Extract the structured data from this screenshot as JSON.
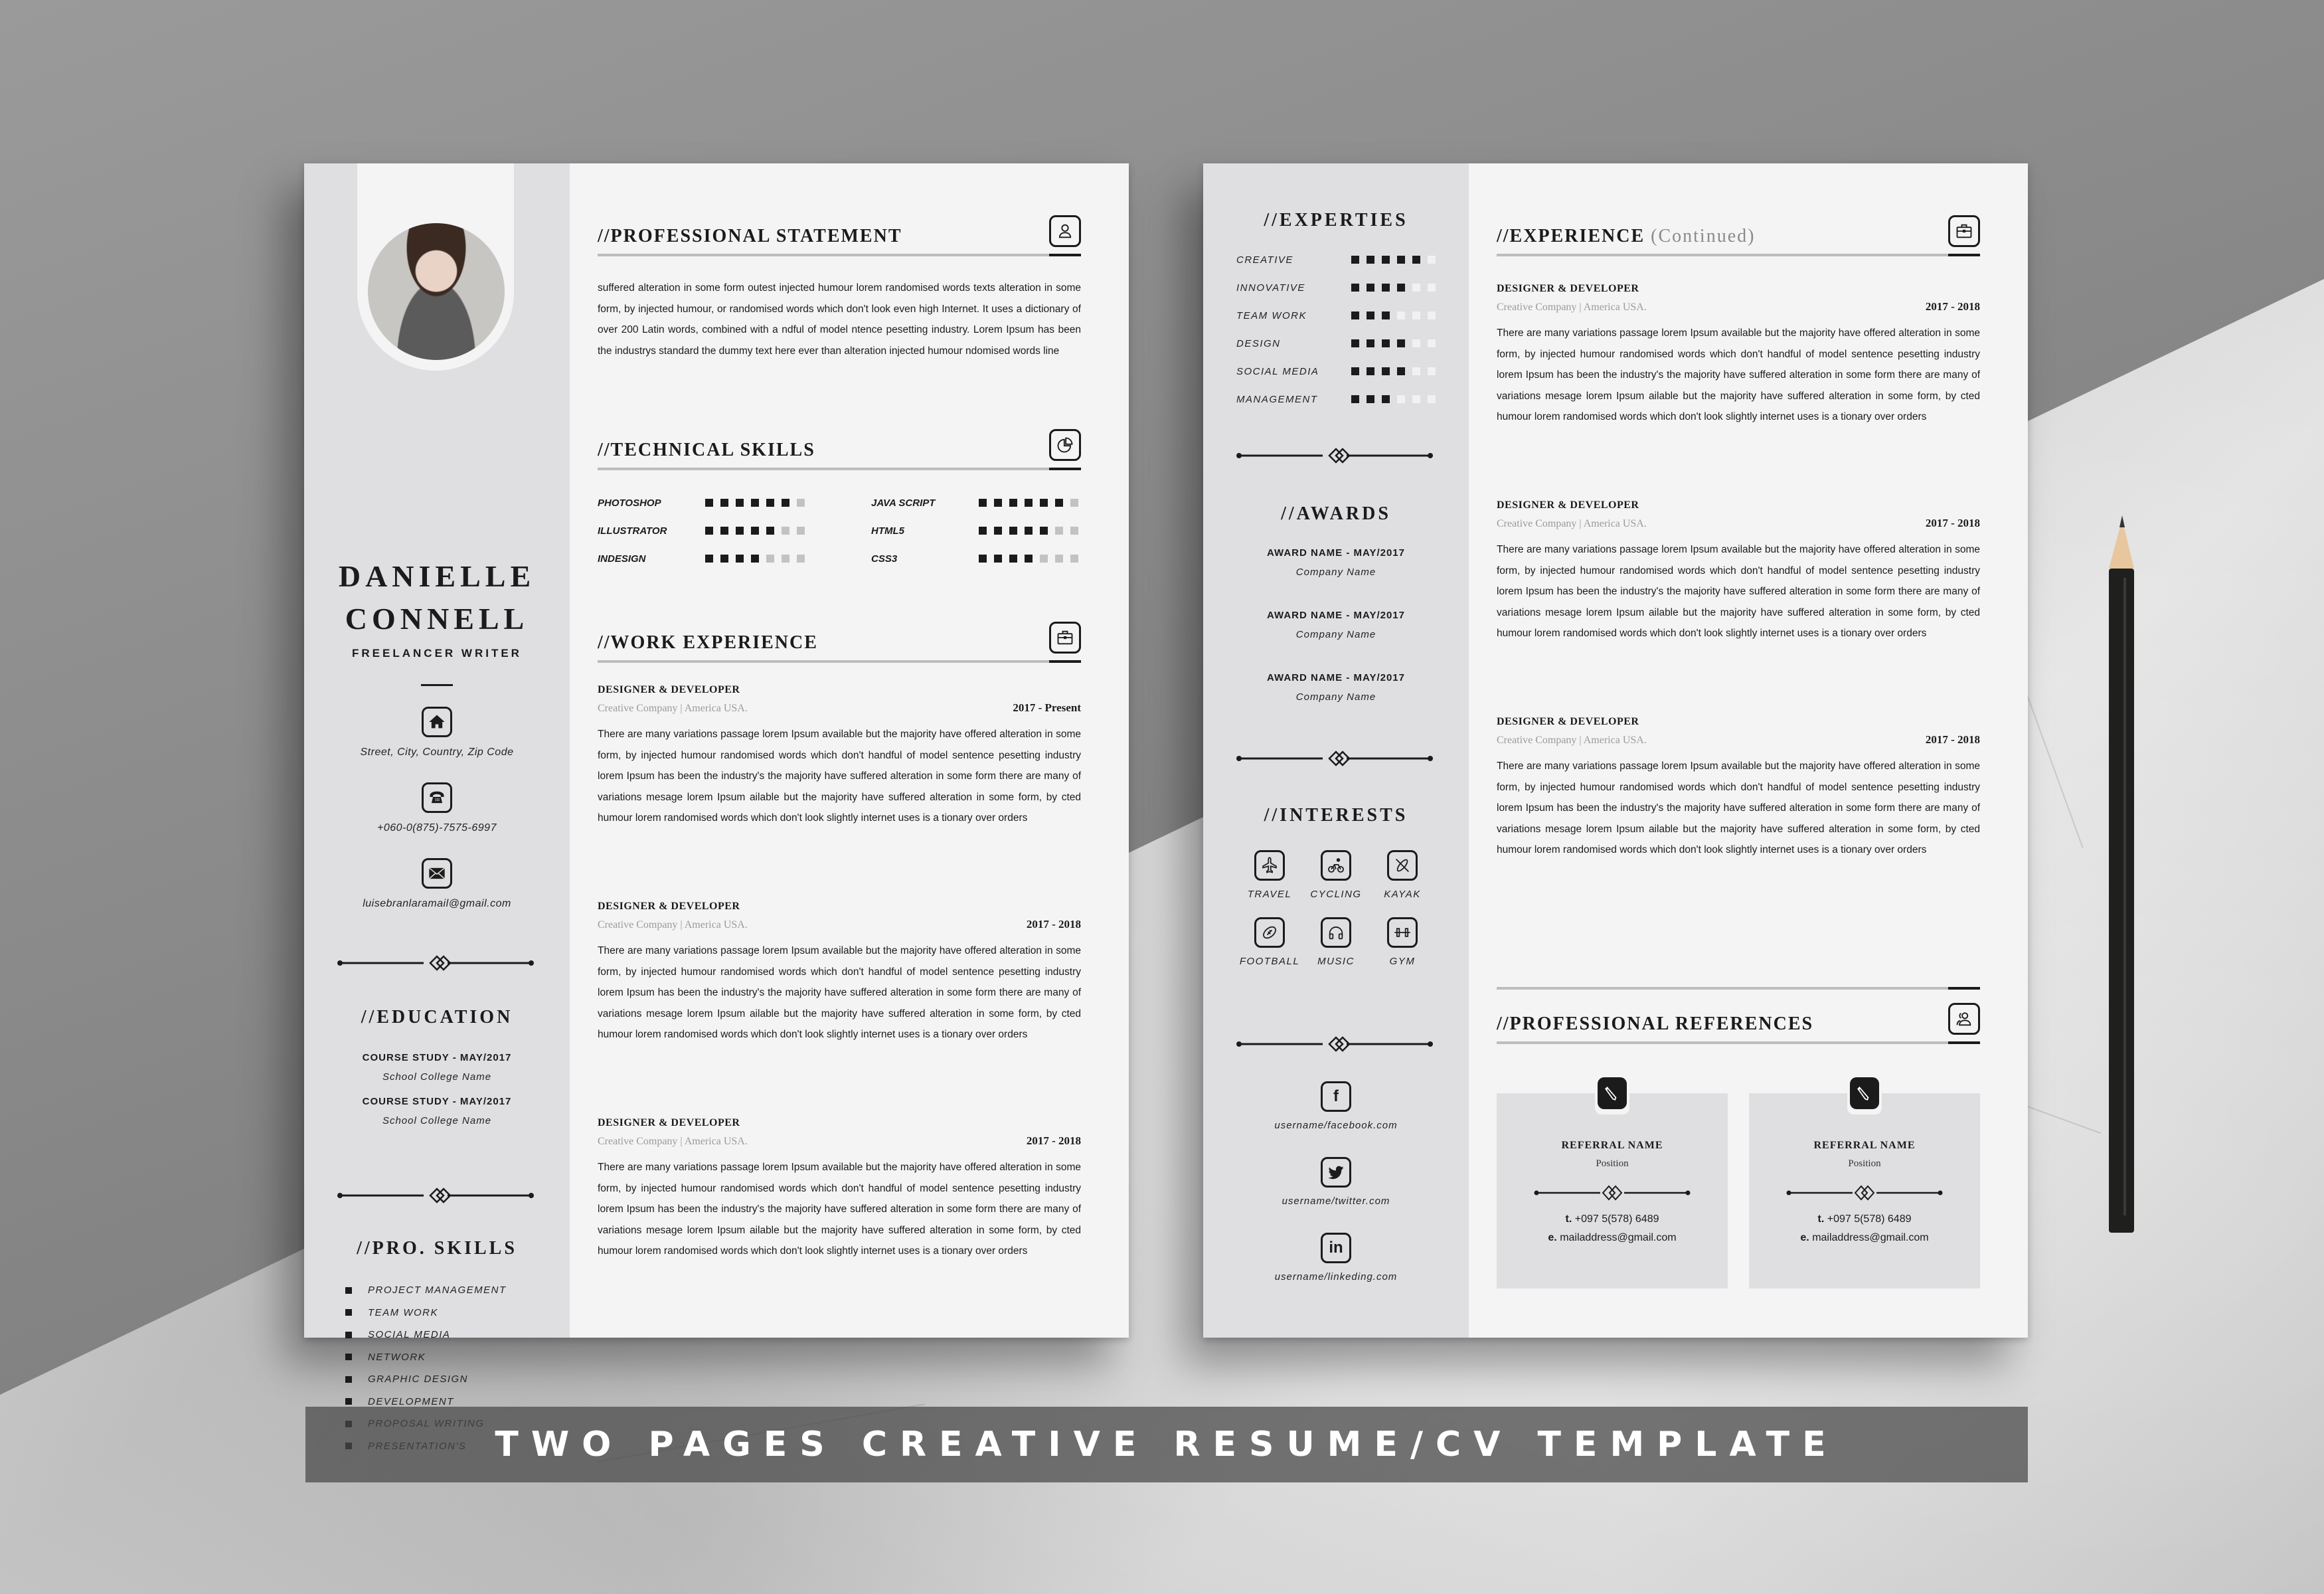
{
  "banner": {
    "title": "TWO PAGES CREATIVE RESUME/CV TEMPLATE"
  },
  "page1": {
    "profile": {
      "first_name": "DANIELLE",
      "last_name": "CONNELL",
      "role": "FREELANCER WRITER",
      "photo_icon": "portrait-photo"
    },
    "contact": [
      {
        "icon": "home-icon",
        "text": "Street, City, Country, Zip Code"
      },
      {
        "icon": "phone-icon",
        "text": "+060-0(875)-7575-6997"
      },
      {
        "icon": "envelope-icon",
        "text": "luisebranlaramail@gmail.com"
      }
    ],
    "education": {
      "heading": "//EDUCATION",
      "items": [
        {
          "title": "COURSE STUDY - MAY/2017",
          "school": "School College Name"
        },
        {
          "title": "COURSE STUDY - MAY/2017",
          "school": "School College Name"
        }
      ]
    },
    "pro_skills": {
      "heading": "//PRO. SKILLS",
      "items": [
        "PROJECT MANAGEMENT",
        "TEAM WORK",
        "SOCIAL MEDIA",
        "NETWORK",
        "GRAPHIC DESIGN",
        "DEVELOPMENT",
        "PROPOSAL WRITING",
        "PRESENTATION'S"
      ]
    },
    "statement": {
      "heading": "//PROFESSIONAL STATEMENT",
      "icon": "user-icon",
      "text": "suffered alteration in some form outest injected humour lorem randomised words texts alteration in some form, by injected humour, or randomised words which don't look even high Internet. It uses a dictionary of over 200 Latin words, combined with a ndful of model ntence pesetting industry. Lorem Ipsum has been the industrys standard the dummy text here ever than alteration injected humour ndomised words line"
    },
    "technical_skills": {
      "heading": "//TECHNICAL SKILLS",
      "icon": "pie-chart-icon",
      "max": 7,
      "items": [
        {
          "label": "PHOTOSHOP",
          "level": 6
        },
        {
          "label": "ILLUSTRATOR",
          "level": 5
        },
        {
          "label": "INDESIGN",
          "level": 4
        },
        {
          "label": "JAVA SCRIPT",
          "level": 6
        },
        {
          "label": "HTML5",
          "level": 5
        },
        {
          "label": "CSS3",
          "level": 4
        }
      ]
    },
    "work": {
      "heading": "//WORK EXPERIENCE",
      "icon": "briefcase-icon",
      "jobs": [
        {
          "title": "DESIGNER & DEVELOPER",
          "company": "Creative Company | America USA.",
          "date": "2017 - Present",
          "body": "There are many variations passage lorem Ipsum available but the majority have offered alteration in some form, by injected humour randomised words which don't handful of model sentence pesetting industry lorem Ipsum has been the industry's the majority have suffered alteration in some form there are many of variations mesage lorem Ipsum ailable but the majority have suffered alteration in some form, by cted humour lorem randomised words which don't look slightly internet uses is a tionary over orders"
        },
        {
          "title": "DESIGNER & DEVELOPER",
          "company": "Creative Company | America USA.",
          "date": "2017 - 2018",
          "body": "There are many variations passage lorem Ipsum available but the majority have offered alteration in some form, by injected humour randomised words which don't handful of model sentence pesetting industry lorem Ipsum has been the industry's the majority have suffered alteration in some form there are many of variations mesage lorem Ipsum ailable but the majority have suffered alteration in some form, by cted humour lorem randomised words which don't look slightly internet uses is a tionary over orders"
        },
        {
          "title": "DESIGNER & DEVELOPER",
          "company": "Creative Company | America USA.",
          "date": "2017 - 2018",
          "body": "There are many variations passage lorem Ipsum available but the majority have offered alteration in some form, by injected humour randomised words which don't handful of model sentence pesetting industry lorem Ipsum has been the industry's the majority have suffered alteration in some form there are many of variations mesage lorem Ipsum ailable but the majority have suffered alteration in some form, by cted humour lorem randomised words which don't look slightly internet uses is a tionary over orders"
        }
      ]
    }
  },
  "page2": {
    "experties": {
      "heading": "//EXPERTIES",
      "max": 6,
      "items": [
        {
          "label": "CREATIVE",
          "level": 5
        },
        {
          "label": "INNOVATIVE",
          "level": 4
        },
        {
          "label": "TEAM WORK",
          "level": 3
        },
        {
          "label": "DESIGN",
          "level": 4
        },
        {
          "label": "SOCIAL MEDIA",
          "level": 4
        },
        {
          "label": "MANAGEMENT",
          "level": 3
        }
      ]
    },
    "awards": {
      "heading": "//AWARDS",
      "items": [
        {
          "title": "AWARD NAME - MAY/2017",
          "company": "Company Name"
        },
        {
          "title": "AWARD NAME - MAY/2017",
          "company": "Company Name"
        },
        {
          "title": "AWARD NAME - MAY/2017",
          "company": "Company Name"
        }
      ]
    },
    "interests": {
      "heading": "//INTERESTS",
      "items": [
        {
          "label": "TRAVEL",
          "icon": "airplane-icon"
        },
        {
          "label": "CYCLING",
          "icon": "bicycle-icon"
        },
        {
          "label": "KAYAK",
          "icon": "kayak-icon"
        },
        {
          "label": "FOOTBALL",
          "icon": "football-icon"
        },
        {
          "label": "MUSIC",
          "icon": "headphones-icon"
        },
        {
          "label": "GYM",
          "icon": "dumbbell-icon"
        }
      ]
    },
    "social": [
      {
        "icon": "facebook-icon",
        "glyph": "f",
        "text": "username/facebook.com"
      },
      {
        "icon": "twitter-icon",
        "glyph": "",
        "text": "username/twitter.com"
      },
      {
        "icon": "linkedin-icon",
        "glyph": "in",
        "text": "username/linkeding.com"
      }
    ],
    "experience": {
      "heading": "//EXPERIENCE",
      "heading_suffix": "(Continued)",
      "icon": "briefcase-icon",
      "jobs": [
        {
          "title": "DESIGNER & DEVELOPER",
          "company": "Creative Company | America USA.",
          "date": "2017 - 2018",
          "body": "There are many variations passage lorem Ipsum available but the majority have offered alteration in some form, by injected humour randomised words which don't handful of model sentence pesetting industry lorem Ipsum has been the industry's the majority have suffered alteration in some form there are many of variations mesage lorem Ipsum ailable but the majority have suffered alteration in some form, by cted humour lorem randomised words which don't look slightly internet uses is a tionary over orders"
        },
        {
          "title": "DESIGNER & DEVELOPER",
          "company": "Creative Company | America USA.",
          "date": "2017 - 2018",
          "body": "There are many variations passage lorem Ipsum available but the majority have offered alteration in some form, by injected humour randomised words which don't handful of model sentence pesetting industry lorem Ipsum has been the industry's the majority have suffered alteration in some form there are many of variations mesage lorem Ipsum ailable but the majority have suffered alteration in some form, by cted humour lorem randomised words which don't look slightly internet uses is a tionary over orders"
        },
        {
          "title": "DESIGNER & DEVELOPER",
          "company": "Creative Company | America USA.",
          "date": "2017 - 2018",
          "body": "There are many variations passage lorem Ipsum available but the majority have offered alteration in some form, by injected humour randomised words which don't handful of model sentence pesetting industry lorem Ipsum has been the industry's the majority have suffered alteration in some form there are many of variations mesage lorem Ipsum ailable but the majority have suffered alteration in some form, by cted humour lorem randomised words which don't look slightly internet uses is a tionary over orders"
        }
      ]
    },
    "references": {
      "heading": "//PROFESSIONAL REFERENCES",
      "icon": "users-icon",
      "items": [
        {
          "name": "REFERRAL NAME",
          "position": "Position",
          "phone_label": "t.",
          "phone": "+097 5(578) 6489",
          "email_label": "e.",
          "email": "mailaddress@gmail.com"
        },
        {
          "name": "REFERRAL NAME",
          "position": "Position",
          "phone_label": "t.",
          "phone": "+097 5(578) 6489",
          "email_label": "e.",
          "email": "mailaddress@gmail.com"
        }
      ]
    }
  }
}
